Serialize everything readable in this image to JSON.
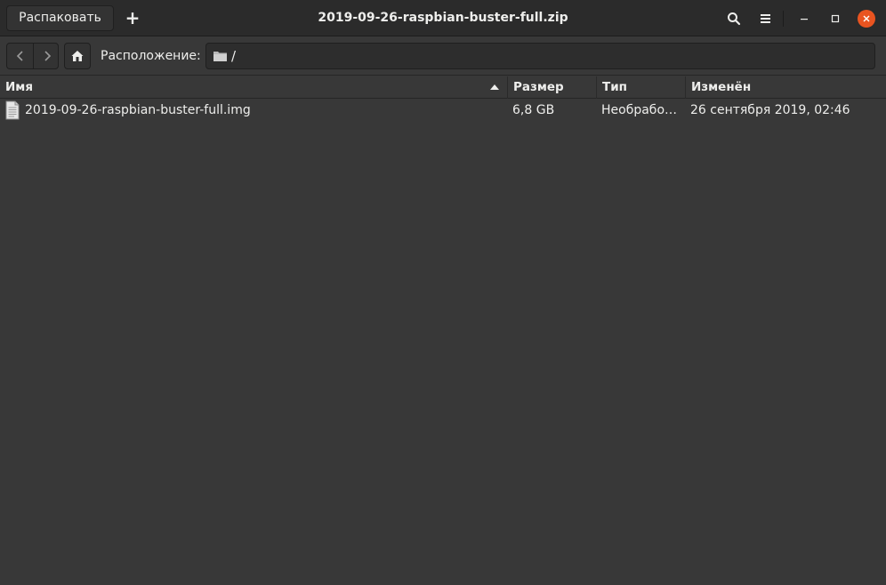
{
  "header": {
    "extract_label": "Распаковать",
    "add_label": "+",
    "title": "2019-09-26-raspbian-buster-full.zip",
    "icons": [
      "search-icon",
      "menu-icon",
      "minimize-icon",
      "maximize-icon",
      "close-icon"
    ]
  },
  "location": {
    "label": "Расположение:",
    "path": "/"
  },
  "columns": {
    "name": "Имя",
    "size": "Размер",
    "type": "Тип",
    "modified": "Изменён"
  },
  "files": [
    {
      "name": "2019-09-26-raspbian-buster-full.img",
      "size": "6,8 GB",
      "type": "Необработанный образ диска",
      "modified": "26 сентября 2019, 02:46",
      "icon": "document-icon"
    }
  ],
  "colors": {
    "accent": "#e95420",
    "background": "#383838",
    "headerbar": "#2b2b2b"
  }
}
